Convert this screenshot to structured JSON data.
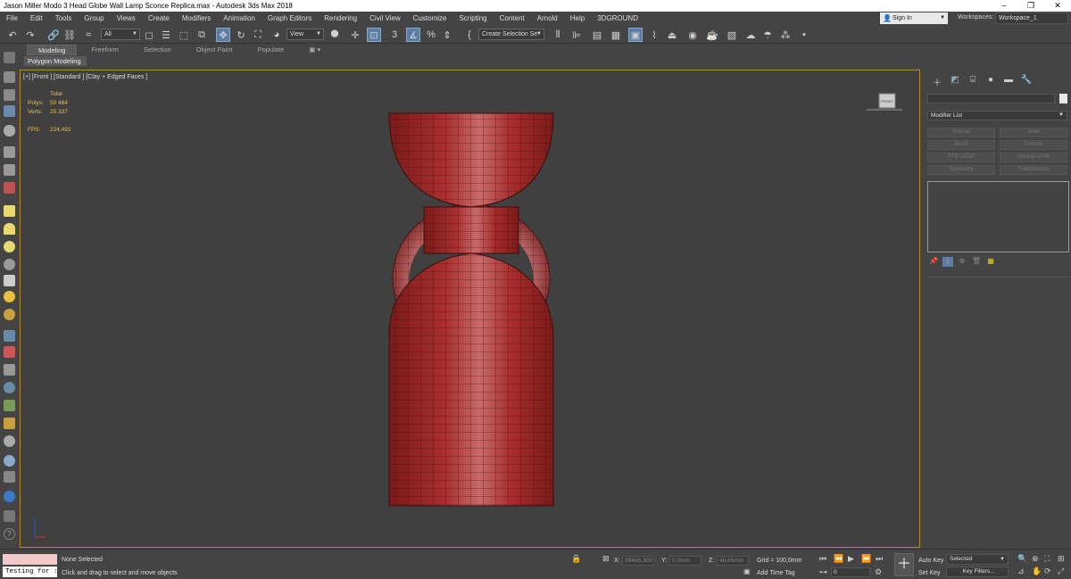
{
  "title": "Jason Miller Modo 3 Head Globe Wall Lamp Sconce Replica.max - Autodesk 3ds Max 2018",
  "window_controls": [
    "–",
    "❐",
    "✕"
  ],
  "menu": [
    "File",
    "Edit",
    "Tools",
    "Group",
    "Views",
    "Create",
    "Modifiers",
    "Animation",
    "Graph Editors",
    "Rendering",
    "Civil View",
    "Customize",
    "Scripting",
    "Content",
    "Arnold",
    "Help",
    "3DGROUND"
  ],
  "signin": "Sign In",
  "workspaces_label": "Workspaces:",
  "workspace_value": "Workspace_1",
  "toolbar": {
    "selection_filter": "All",
    "ref_coord": "View",
    "named_selection": "Create Selection Se"
  },
  "ribbon": {
    "tabs": [
      "Modeling",
      "Freeform",
      "Selection",
      "Object Paint",
      "Populate"
    ],
    "active_tab": "Modeling",
    "panel_label": "Polygon Modeling"
  },
  "viewport": {
    "label": "[+] [Front ] [Standard ] [Clay + Edged Faces ]",
    "stats": {
      "total_label": "Total",
      "polys_label": "Polys:",
      "polys_value": "50 464",
      "verts_label": "Verts:",
      "verts_value": "25 337",
      "fps_label": "FPS:",
      "fps_value": "224,492"
    },
    "navcube_label": "FRONT"
  },
  "command_panel": {
    "modifier_list": "Modifier List",
    "modifier_buttons": [
      "Normal",
      "Shell",
      "Bend",
      "Smooth",
      "FFD 2x2x2",
      "Unwrap UVW",
      "Symmetry",
      "TurboSmooth"
    ]
  },
  "status": {
    "selection": "None Selected",
    "prompt": "Click and drag to select and move objects",
    "maxscript_text": "Testing for :",
    "x_label": "X:",
    "x_value": "39436,303",
    "y_label": "Y:",
    "y_value": "0,0mm",
    "z_label": "Z:",
    "z_value": "46,65mm",
    "grid": "Grid = 100,0mm",
    "add_time_tag": "Add Time Tag",
    "frame": "0",
    "auto_key": "Auto Key",
    "set_key": "Set Key",
    "key_mode": "Selected",
    "key_filters": "Key Filters..."
  },
  "colors": {
    "model": "#9b2424",
    "model_light": "#b94646",
    "viewport_border": "#b08a33",
    "stats": "#e8c04a",
    "accent": "#5a7ea8"
  }
}
